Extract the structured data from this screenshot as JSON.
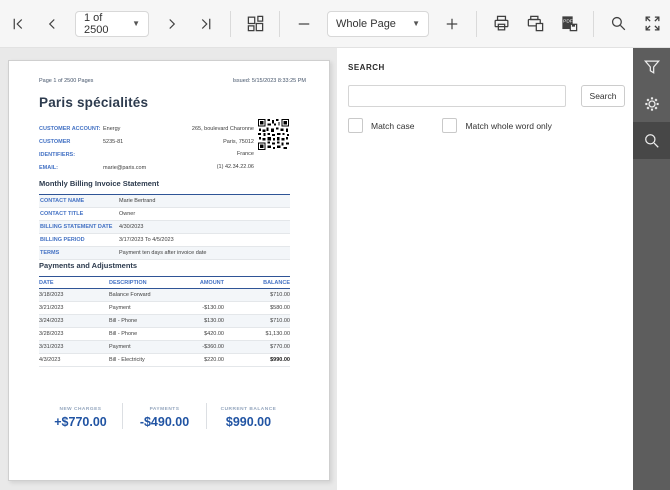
{
  "toolbar": {
    "page_combo": "1 of 2500",
    "zoom_combo": "Whole Page",
    "icons": [
      "first-page",
      "previous-page",
      "next-page",
      "last-page",
      "multipage-view",
      "zoom-out",
      "zoom-in",
      "print",
      "print-page",
      "export-pdf",
      "search",
      "fullscreen"
    ]
  },
  "search_panel": {
    "title": "SEARCH",
    "input_value": "",
    "button_label": "Search",
    "match_case_label": "Match case",
    "match_whole_word_label": "Match whole word only"
  },
  "side_tabs": [
    "filter",
    "settings",
    "search"
  ],
  "document": {
    "page_info": "Page 1 of 2500 Pages",
    "issued": "Issued: 5/15/2023 8:33:25 PM",
    "title": "Paris spécialités",
    "customer_fields": [
      {
        "label": "CUSTOMER ACCOUNT:",
        "value": "Energy"
      },
      {
        "label": "CUSTOMER IDENTIFIERS:",
        "value": "5235-81"
      },
      {
        "label": "EMAIL:",
        "value": "marie@paris.com"
      }
    ],
    "address_lines": [
      "265, boulevard Charonne",
      "Paris,  75012",
      "France",
      "(1) 42.34.22.06"
    ],
    "statement": {
      "title": "Monthly Billing Invoice Statement",
      "fields": [
        {
          "label": "CONTACT NAME",
          "value": "Marie Bertrand"
        },
        {
          "label": "CONTACT TITLE",
          "value": "Owner"
        },
        {
          "label": "BILLING STATEMENT DATE",
          "value": "4/30/2023"
        },
        {
          "label": "BILLING PERIOD",
          "value": "3/17/2023 To 4/5/2023"
        },
        {
          "label": "TERMS",
          "value": "Payment ten days after invoice date"
        }
      ]
    },
    "payments": {
      "title": "Payments and Adjustments",
      "headers": [
        "DATE",
        "DESCRIPTION",
        "AMOUNT",
        "BALANCE"
      ],
      "rows": [
        {
          "date": "3/18/2023",
          "description": "Balance Forward",
          "amount": "",
          "balance": "$710.00"
        },
        {
          "date": "3/21/2023",
          "description": "Payment",
          "amount": "-$130.00",
          "balance": "$580.00"
        },
        {
          "date": "3/24/2023",
          "description": "Bill - Phone",
          "amount": "$130.00",
          "balance": "$710.00"
        },
        {
          "date": "3/28/2023",
          "description": "Bill - Phone",
          "amount": "$420.00",
          "balance": "$1,130.00"
        },
        {
          "date": "3/31/2023",
          "description": "Payment",
          "amount": "-$360.00",
          "balance": "$770.00"
        },
        {
          "date": "4/3/2023",
          "description": "Bill - Electricity",
          "amount": "$220.00",
          "balance": "$990.00"
        }
      ]
    },
    "summary": [
      {
        "label": "NEW CHARGES",
        "value": "+$770.00"
      },
      {
        "label": "PAYMENTS",
        "value": "-$490.00"
      },
      {
        "label": "CURRENT BALANCE",
        "value": "$990.00"
      }
    ]
  },
  "colors": {
    "label_blue": "#4472c4",
    "header_navy": "#2f5496",
    "summary_blue": "#2154a3",
    "sidebar_bg": "#5d5d5d",
    "sidebar_active": "#474747",
    "toolbar_bg": "#f6f6f6",
    "preview_bg": "#e9e9e9"
  }
}
